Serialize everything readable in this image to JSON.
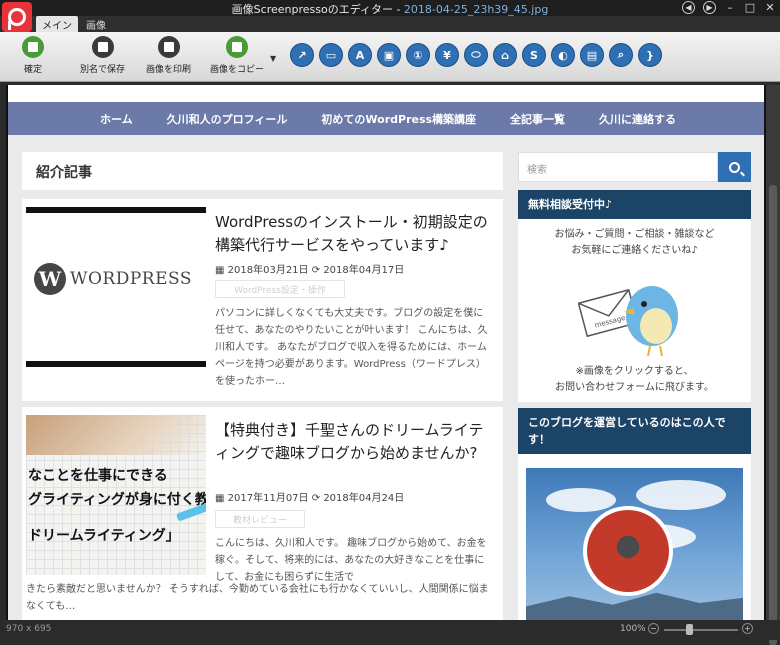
{
  "window": {
    "title_prefix": "画像Screenpressoのエディター - ",
    "filename": "2018-04-25_23h39_45.jpg"
  },
  "ribbon_tabs": [
    "メイン",
    "画像"
  ],
  "ribbon_buttons": {
    "confirm": "確定",
    "save_as": "別名で保存",
    "print": "画像を印刷",
    "copy": "画像をコピー"
  },
  "tools": [
    "arrow-tool",
    "rectangle-tool",
    "text-tool",
    "callout-tool",
    "numbering-tool",
    "stamp-tool",
    "ellipse-tool",
    "polygon-tool",
    "freehand-tool",
    "blur-tool",
    "image-tool",
    "magnifier-tool",
    "bracket-tool"
  ],
  "site": {
    "nav": [
      "ホーム",
      "久川和人のプロフィール",
      "初めてのWordPress構築講座",
      "全記事一覧",
      "久川に連絡する"
    ],
    "section_heading": "紹介記事",
    "posts": [
      {
        "title": "WordPressのインストール・初期設定の構築代行サービスをやっています♪",
        "date": "2018年03月21日",
        "updated": "2018年04月17日",
        "category": "WordPress設定・操作",
        "excerpt": "パソコンに詳しくなくても大丈夫です。ブログの設定を僕に任せて、あなたのやりたいことが叶います！ こんにちは、久川和人です。 あなたがブログで収入を得るためには、ホームページを持つ必要があります。WordPress（ワードプレス）を使ったホー…",
        "thumb_logo": "W",
        "thumb_word": "WORDPRESS"
      },
      {
        "title": "【特典付き】千聖さんのドリームライティングで趣味ブログから始めませんか?",
        "date": "2017年11月07日",
        "updated": "2018年04月24日",
        "category": "教材レビュー",
        "excerpt_a": "こんにちは、久川和人です。 趣味ブログから始めて、お金を稼ぐ。そして、将来的には、あなたの大好きなことを仕事にして、お金にも困らずに生活で",
        "excerpt_b": "きたら素敵だと思いませんか？ そうすれば、今勤めている会社にも行かなくていいし、人間関係に悩まなくても…",
        "thumb_lines": [
          "なことを仕事にできる",
          "グライティングが身に付く教科",
          "ドリームライティング」"
        ]
      }
    ],
    "search_placeholder": "検索",
    "widget1": {
      "title": "無料相談受付中♪",
      "text1": "お悩み・ご質問・ご相談・雑談など",
      "text2": "お気軽にご連絡くださいね♪",
      "envelope_label": "message",
      "text3": "※画像をクリックすると、",
      "text4": "お問い合わせフォームに飛びます。"
    },
    "widget2": {
      "title": "このブログを運営しているのはこの人です！"
    }
  },
  "status": {
    "dimensions": "970 x 695",
    "zoom": "100%"
  },
  "colors": {
    "nav": "#6b7aa8",
    "widget_title": "#1c4466",
    "accent": "#2f6fb3",
    "brand": "#e8333a"
  }
}
